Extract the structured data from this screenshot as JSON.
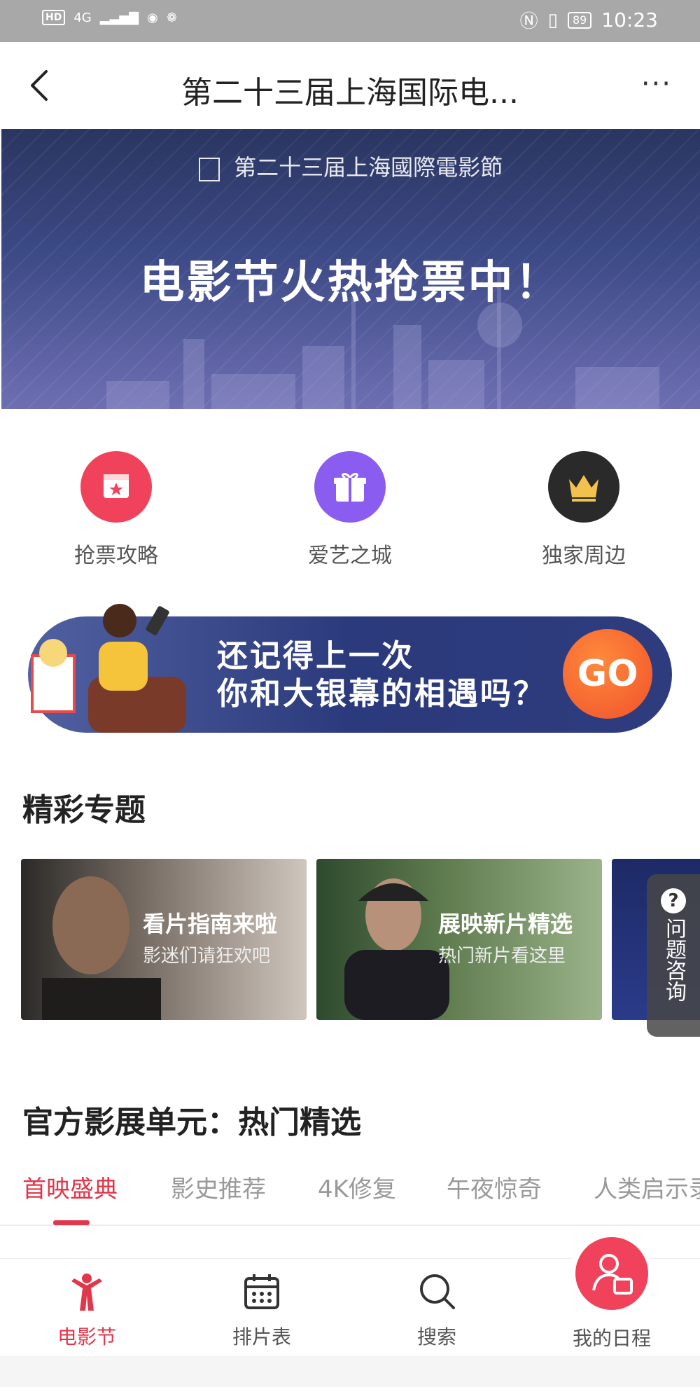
{
  "status_bar": {
    "left_hd": "HD",
    "left_net": "4G",
    "battery": "89",
    "time": "10:23"
  },
  "header": {
    "title": "第二十三届上海国际电..."
  },
  "banner": {
    "top_text": "第二十三届上海國際電影節",
    "headline": "电影节火热抢票中！"
  },
  "quick_links": [
    {
      "label": "抢票攻略",
      "icon": "calendar-star-icon",
      "color": "#f0425a"
    },
    {
      "label": "爱艺之城",
      "icon": "gift-icon",
      "color": "#8a5cf0"
    },
    {
      "label": "独家周边",
      "icon": "crown-icon",
      "color": "#2a2a2a"
    }
  ],
  "promo": {
    "line1": "还记得上一次",
    "line2": "你和大银幕的相遇吗？",
    "go": "GO"
  },
  "topics": {
    "title": "精彩专题",
    "cards": [
      {
        "title": "看片指南来啦",
        "subtitle": "影迷们请狂欢吧"
      },
      {
        "title": "展映新片精选",
        "subtitle": "热门新片看这里"
      }
    ]
  },
  "help": {
    "label": "问题咨询",
    "icon": "?"
  },
  "official": {
    "title": "官方影展单元：热门精选",
    "tabs": [
      "首映盛典",
      "影史推荐",
      "4K修复",
      "午夜惊奇",
      "人类启示录"
    ]
  },
  "bottom_nav": [
    {
      "label": "电影节",
      "icon": "festival-icon"
    },
    {
      "label": "排片表",
      "icon": "calendar-icon"
    },
    {
      "label": "搜索",
      "icon": "search-icon"
    },
    {
      "label": "我的日程",
      "icon": "schedule-icon"
    }
  ],
  "colors": {
    "accent": "#e2364a"
  }
}
